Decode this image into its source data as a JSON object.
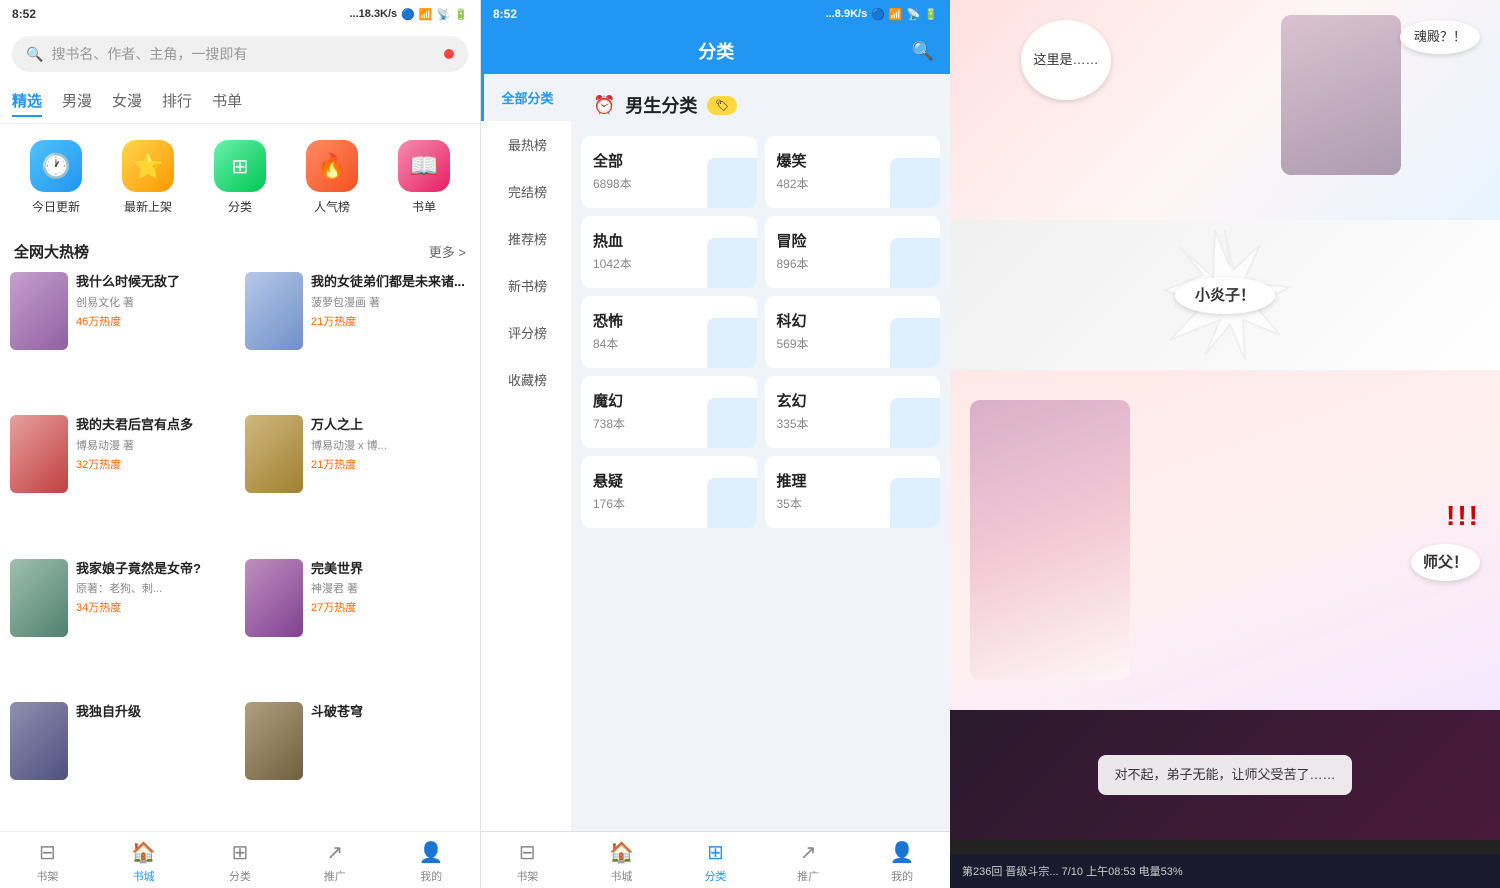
{
  "left": {
    "status": {
      "time": "8:52",
      "network": "...18.3K/s",
      "battery": "53"
    },
    "search": {
      "placeholder": "搜书名、作者、主角，一搜即有"
    },
    "nav": {
      "tabs": [
        "精选",
        "男漫",
        "女漫",
        "排行",
        "书单"
      ],
      "active": 0
    },
    "icons": [
      {
        "label": "今日更新",
        "icon": "🕐",
        "color": "ic-blue"
      },
      {
        "label": "最新上架",
        "icon": "⭐",
        "color": "ic-yellow"
      },
      {
        "label": "分类",
        "icon": "⊞",
        "color": "ic-green"
      },
      {
        "label": "人气榜",
        "icon": "🔥",
        "color": "ic-orange"
      },
      {
        "label": "书单",
        "icon": "📖",
        "color": "ic-pink"
      }
    ],
    "hot_section": {
      "title": "全网大热榜",
      "more": "更多 >"
    },
    "books": [
      {
        "title": "我什么时候无敌了",
        "author": "创易文化 著",
        "hot": "46万热度",
        "cover_color": "#c8a0d0"
      },
      {
        "title": "我的女徒弟们都是未来诸...",
        "author": "菠萝包漫画 著",
        "hot": "21万热度",
        "cover_color": "#b8c8e8"
      },
      {
        "title": "我的夫君后宫有点多",
        "author": "博易动漫 著",
        "hot": "32万热度",
        "cover_color": "#e8a0a0"
      },
      {
        "title": "万人之上",
        "author": "博易动漫 x 博...",
        "hot": "21万热度",
        "cover_color": "#d0b880"
      },
      {
        "title": "我家娘子竟然是女帝?",
        "author": "原著：老狗、刺...",
        "hot": "34万热度",
        "cover_color": "#a0c0b0"
      },
      {
        "title": "完美世界",
        "author": "神漫君 著",
        "hot": "27万热度",
        "cover_color": "#c090c0"
      },
      {
        "title": "我独自升级",
        "author": "",
        "hot": "",
        "cover_color": "#9090b0"
      },
      {
        "title": "斗破苍穹",
        "author": "",
        "hot": "",
        "cover_color": "#b0a080"
      }
    ],
    "bottom_nav": [
      {
        "label": "书架",
        "icon": "⊟",
        "active": false
      },
      {
        "label": "书城",
        "icon": "🏠",
        "active": true
      },
      {
        "label": "分类",
        "icon": "⊞",
        "active": false
      },
      {
        "label": "推广",
        "icon": "↗",
        "active": false
      },
      {
        "label": "我的",
        "icon": "👤",
        "active": false
      }
    ]
  },
  "mid": {
    "status": {
      "time": "8:52",
      "network": "...8.9K/s",
      "battery": "53"
    },
    "header": {
      "title": "分类",
      "search_icon": "🔍"
    },
    "sidebar": [
      {
        "label": "全部分类",
        "active": true
      },
      {
        "label": "最热榜",
        "active": false
      },
      {
        "label": "完结榜",
        "active": false
      },
      {
        "label": "推荐榜",
        "active": false
      },
      {
        "label": "新书榜",
        "active": false
      },
      {
        "label": "评分榜",
        "active": false
      },
      {
        "label": "收藏榜",
        "active": false
      }
    ],
    "section": {
      "icon": "⏰",
      "title": "男生分类",
      "tag": "🏷"
    },
    "categories": [
      {
        "title": "全部",
        "count": "6898本"
      },
      {
        "title": "爆笑",
        "count": "482本"
      },
      {
        "title": "热血",
        "count": "1042本"
      },
      {
        "title": "冒险",
        "count": "896本"
      },
      {
        "title": "恐怖",
        "count": "84本"
      },
      {
        "title": "科幻",
        "count": "569本"
      },
      {
        "title": "魔幻",
        "count": "738本"
      },
      {
        "title": "玄幻",
        "count": "335本"
      },
      {
        "title": "悬疑",
        "count": "176本"
      },
      {
        "title": "推理",
        "count": "35本"
      }
    ],
    "bottom_nav": [
      {
        "label": "书架",
        "icon": "⊟",
        "active": false
      },
      {
        "label": "书城",
        "icon": "🏠",
        "active": false
      },
      {
        "label": "分类",
        "icon": "⊞",
        "active": true
      },
      {
        "label": "推广",
        "icon": "↗",
        "active": false
      },
      {
        "label": "我的",
        "icon": "👤",
        "active": false
      }
    ]
  },
  "right": {
    "manga_pages": [
      {
        "bubble1": "这里是……",
        "bubble2": "魂殿？！"
      },
      {
        "text": "小炎子！"
      },
      {
        "text": "师父！"
      },
      {
        "text": "对不起，弟子无能，让师父受苦了……"
      }
    ],
    "bottom_bar": "第236回 晋级斗宗... 7/10 上午08:53 电量53%"
  }
}
